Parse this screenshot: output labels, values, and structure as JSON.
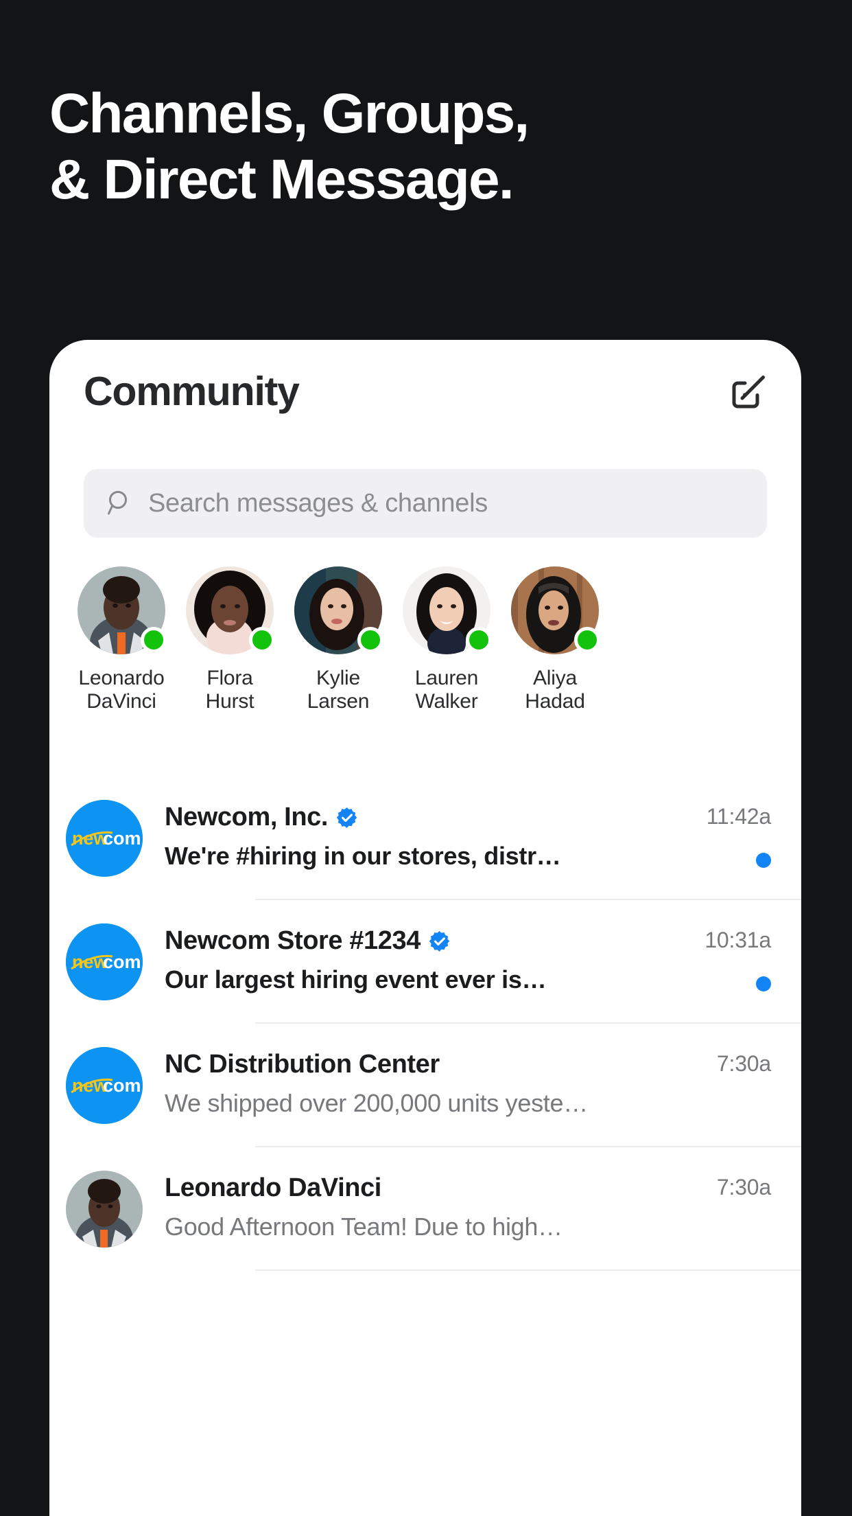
{
  "headline": {
    "line1": "Channels, Groups,",
    "line2": "& Direct Message."
  },
  "card": {
    "title": "Community",
    "compose_icon": "compose-edit-icon"
  },
  "search": {
    "icon": "search-icon",
    "placeholder": "Search messages & channels",
    "value": ""
  },
  "people": [
    {
      "name": "Leonardo\nDaVinci",
      "status": "online"
    },
    {
      "name": "Flora\nHurst",
      "status": "online"
    },
    {
      "name": "Kylie\nLarsen",
      "status": "online"
    },
    {
      "name": "Lauren\nWalker",
      "status": "online"
    },
    {
      "name": "Aliya\nHadad",
      "status": "online"
    }
  ],
  "messages": [
    {
      "name": "Newcom, Inc.",
      "verified": true,
      "preview": "We're #hiring in our stores, distr…",
      "time": "11:42a",
      "unread": true,
      "avatar": "newcom-logo"
    },
    {
      "name": "Newcom Store #1234",
      "verified": true,
      "preview": "Our largest hiring event ever is…",
      "time": "10:31a",
      "unread": true,
      "avatar": "newcom-logo"
    },
    {
      "name": "NC Distribution Center",
      "verified": false,
      "preview": "We shipped over 200,000 units yeste…",
      "time": "7:30a",
      "unread": false,
      "avatar": "newcom-logo"
    },
    {
      "name": "Leonardo DaVinci",
      "verified": false,
      "preview": "Good Afternoon Team!  Due to high…",
      "time": "7:30a",
      "unread": false,
      "avatar": "person-photo"
    }
  ],
  "colors": {
    "background": "#131416",
    "card": "#ffffff",
    "accent_blue": "#1384F5",
    "brand_blue": "#0D93F2",
    "brand_yellow": "#F5C518",
    "status_green": "#13C20B",
    "search_field": "#f0f0f3",
    "text_primary": "#1b1c1d",
    "text_secondary": "#76787c"
  }
}
